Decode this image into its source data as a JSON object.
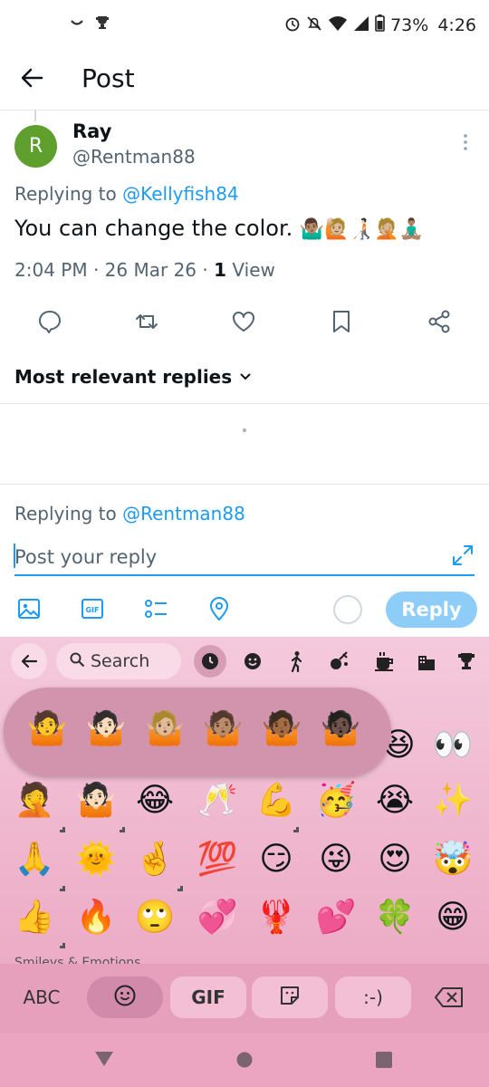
{
  "status_bar": {
    "time": "4:26",
    "battery": "73%",
    "left_icons": [
      "smile-icon",
      "trophy-icon"
    ],
    "right_icons": [
      "alarm-icon",
      "mute-icon",
      "wifi-icon",
      "signal-icon",
      "battery-icon"
    ]
  },
  "header": {
    "title": "Post"
  },
  "tweet": {
    "author": {
      "name": "Ray",
      "handle": "@Rentman88",
      "avatar_letter": "R",
      "avatar_color": "#5e9f2e"
    },
    "replying_prefix": "Replying to",
    "replying_handle": "@Kellyfish84",
    "text": "You can change the color.",
    "emojis": "🤷🏽‍♂️🙋🏼🧑🏻‍🦯🤦🏼🧘🏽‍♂️",
    "time": "2:04 PM",
    "date": "26 Mar 26",
    "views_count": "1",
    "views_label": "View",
    "actions": [
      "reply-icon",
      "retweet-icon",
      "like-icon",
      "bookmark-icon",
      "share-icon"
    ]
  },
  "replies_sort": {
    "label": "Most relevant replies"
  },
  "composer": {
    "replying_prefix": "Replying to",
    "replying_handle": "@Rentman88",
    "placeholder": "Post your reply",
    "reply_button": "Reply",
    "tools": [
      "image-icon",
      "gif-icon",
      "poll-icon",
      "location-icon"
    ]
  },
  "keyboard": {
    "search_placeholder": "Search",
    "categories": [
      "recent-icon",
      "smiley-icon",
      "person-icon",
      "activity-icon",
      "food-icon",
      "places-icon",
      "trophy-icon"
    ],
    "skin_tones": [
      "🤷",
      "🤷🏻",
      "🤷🏼",
      "🤷🏽",
      "🤷🏾",
      "🤷🏿"
    ],
    "rows": [
      [
        "😆",
        "👀"
      ],
      [
        "🤦",
        "🤷🏻",
        "😂",
        "🥂",
        "💪",
        "🥳",
        "😭",
        "✨"
      ],
      [
        "🙏",
        "🌞",
        "🤞",
        "💯",
        "😏",
        "😜",
        "😍",
        "🤯"
      ],
      [
        "👍",
        "🔥",
        "🙄",
        "💞",
        "🦞",
        "💕",
        "🍀",
        "😁"
      ]
    ],
    "section_label": "Smileys & Emotions",
    "bottom_keys": {
      "abc": "ABC",
      "gif": "GIF",
      "emoticon": ":-)"
    }
  },
  "colors": {
    "accent": "#1d9bf0",
    "keyboard_bg": "#f4c9dc"
  }
}
